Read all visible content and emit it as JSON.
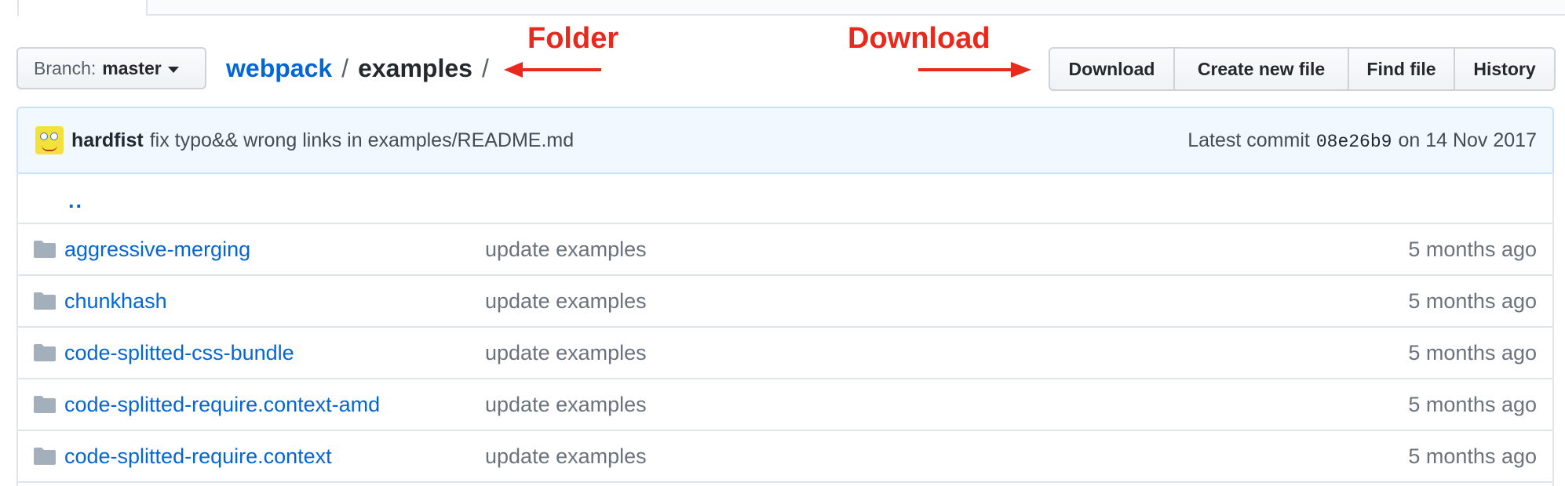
{
  "branch": {
    "prefix": "Branch:",
    "name": "master"
  },
  "breadcrumb": {
    "repo": "webpack",
    "sep1": "/",
    "folder": "examples",
    "sep2": "/"
  },
  "annotations": {
    "folder_label": "Folder",
    "download_label": "Download",
    "color": "#e8291c"
  },
  "toolbar": {
    "buttons": [
      "Download",
      "Create new file",
      "Find file",
      "History"
    ]
  },
  "commit": {
    "author": "hardfist",
    "message": "fix typo&& wrong links in examples/README.md",
    "latest_prefix": "Latest commit",
    "sha": "08e26b9",
    "date_text": "on 14 Nov 2017"
  },
  "files": {
    "parent": "..",
    "rows": [
      {
        "name": "aggressive-merging",
        "message": "update examples",
        "age": "5 months ago"
      },
      {
        "name": "chunkhash",
        "message": "update examples",
        "age": "5 months ago"
      },
      {
        "name": "code-splitted-css-bundle",
        "message": "update examples",
        "age": "5 months ago"
      },
      {
        "name": "code-splitted-require.context-amd",
        "message": "update examples",
        "age": "5 months ago"
      },
      {
        "name": "code-splitted-require.context",
        "message": "update examples",
        "age": "5 months ago"
      }
    ]
  },
  "colors": {
    "link": "#0366d6",
    "muted": "#6a737d",
    "commit_bg": "#f1f8ff"
  }
}
